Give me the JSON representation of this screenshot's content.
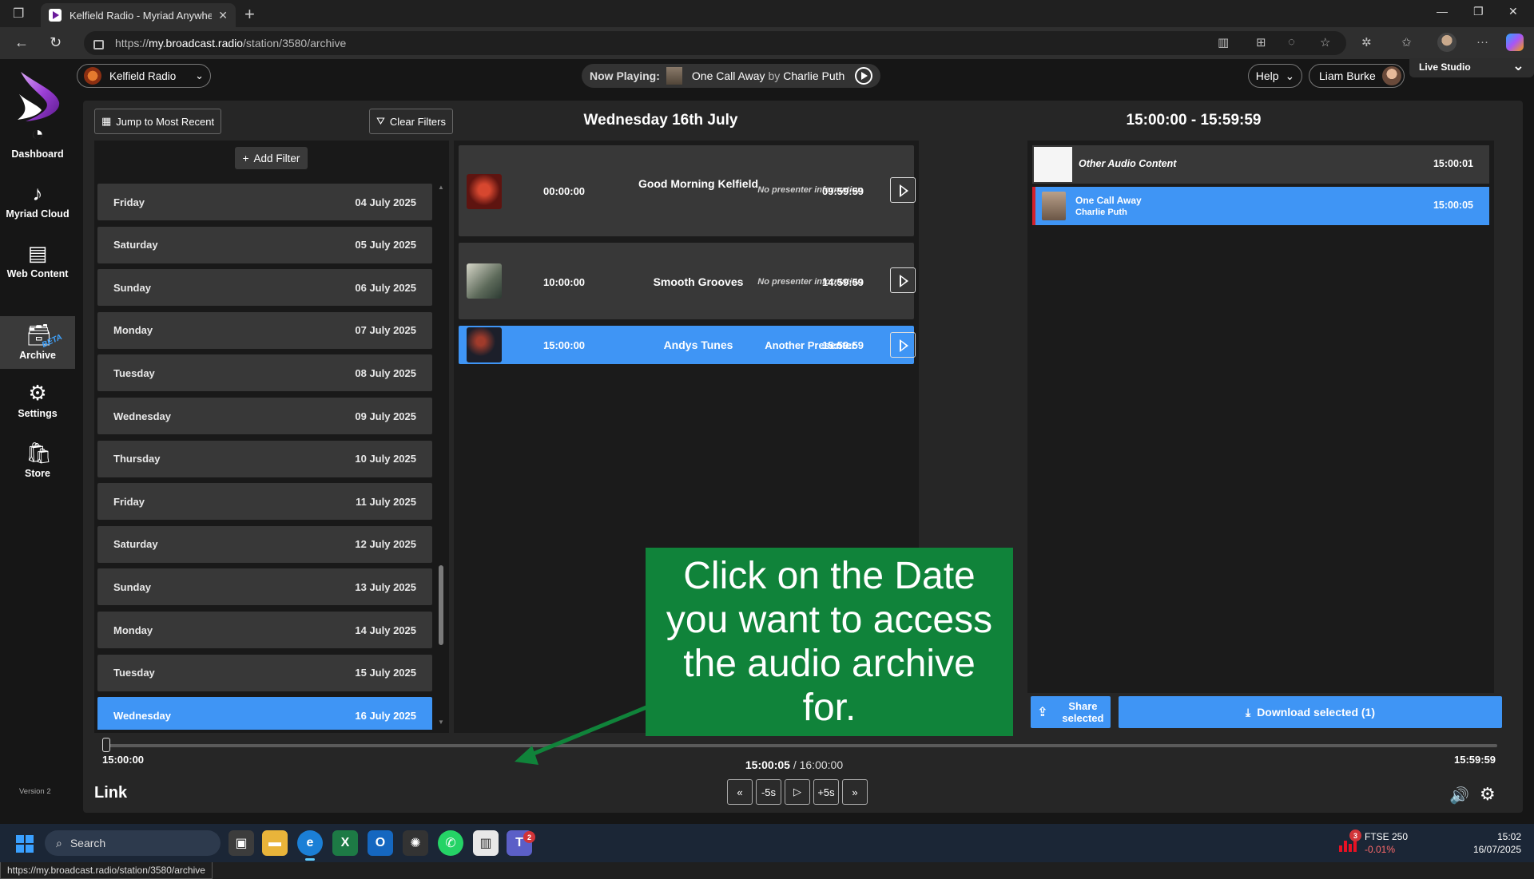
{
  "browser": {
    "tab_title": "Kelfield Radio - Myriad Anywhere",
    "url_prefix": "https://",
    "url_host": "my.broadcast.radio",
    "url_path": "/station/3580/archive",
    "status_url": "https://my.broadcast.radio/station/3580/archive"
  },
  "nav": {
    "items": [
      {
        "label": "Dashboard",
        "icon": "gauge-icon"
      },
      {
        "label": "Myriad Cloud",
        "icon": "music-note-icon"
      },
      {
        "label": "Web Content",
        "icon": "web-content-icon"
      },
      {
        "label": "Archive",
        "icon": "archive-icon",
        "active": true
      },
      {
        "label": "Settings",
        "icon": "gear-icon"
      },
      {
        "label": "Store",
        "icon": "store-icon"
      }
    ],
    "beta": "BETA",
    "version": "Version 2"
  },
  "topbar": {
    "station": "Kelfield Radio",
    "now_playing_label": "Now Playing:",
    "now_playing_title": "One Call Away",
    "now_playing_by": "by",
    "now_playing_artist": "Charlie Puth",
    "help": "Help",
    "user": "Liam Burke",
    "studio": "Live Studio"
  },
  "toolbar": {
    "jump_label": "Jump to Most Recent",
    "clear_label": "Clear Filters",
    "add_filter_label": "Add Filter"
  },
  "day_title": "Wednesday 16th July",
  "range_title": "15:00:00 - 15:59:59",
  "dates": [
    {
      "day": "Friday",
      "date": "04 July 2025"
    },
    {
      "day": "Saturday",
      "date": "05 July 2025"
    },
    {
      "day": "Sunday",
      "date": "06 July 2025"
    },
    {
      "day": "Monday",
      "date": "07 July 2025"
    },
    {
      "day": "Tuesday",
      "date": "08 July 2025"
    },
    {
      "day": "Wednesday",
      "date": "09 July 2025"
    },
    {
      "day": "Thursday",
      "date": "10 July 2025"
    },
    {
      "day": "Friday",
      "date": "11 July 2025"
    },
    {
      "day": "Saturday",
      "date": "12 July 2025"
    },
    {
      "day": "Sunday",
      "date": "13 July 2025"
    },
    {
      "day": "Monday",
      "date": "14 July 2025"
    },
    {
      "day": "Tuesday",
      "date": "15 July 2025"
    },
    {
      "day": "Wednesday",
      "date": "16 July 2025",
      "active": true
    }
  ],
  "shows": [
    {
      "start": "00:00:00",
      "name": "Good Morning Kelfield",
      "presenter": "No presenter information",
      "end": "09:59:59"
    },
    {
      "start": "10:00:00",
      "name": "Smooth Grooves",
      "presenter": "No presenter information",
      "end": "14:59:59"
    },
    {
      "start": "15:00:00",
      "name": "Andys Tunes",
      "presenter": "Another Presenter",
      "end": "15:59:59",
      "active": true
    }
  ],
  "items": [
    {
      "title": "Other Audio Content",
      "time": "15:00:01"
    },
    {
      "title": "One Call Away",
      "artist": "Charlie Puth",
      "time": "15:00:05",
      "active": true
    }
  ],
  "actions": {
    "share_label_1": "Share",
    "share_label_2": "selected",
    "download_label": "Download selected (1)"
  },
  "player": {
    "start": "15:00:00",
    "end": "15:59:59",
    "position": "15:00:05",
    "separator": " / ",
    "total": "16:00:00",
    "progress": 0.0014,
    "link_label": "Link",
    "back5": "-5s",
    "fwd5": "+5s"
  },
  "callout": "Click on the Date you want to access the audio archive for.",
  "taskbar": {
    "search": "Search",
    "ticker_name": "FTSE 250",
    "ticker_change": "-0.01%",
    "ticker_badge": "3",
    "teams_badge": "2",
    "time": "15:02",
    "date": "16/07/2025"
  },
  "colors": {
    "accent": "#3f95f5",
    "callout": "#10833a",
    "active_marker": "#d3202a"
  }
}
